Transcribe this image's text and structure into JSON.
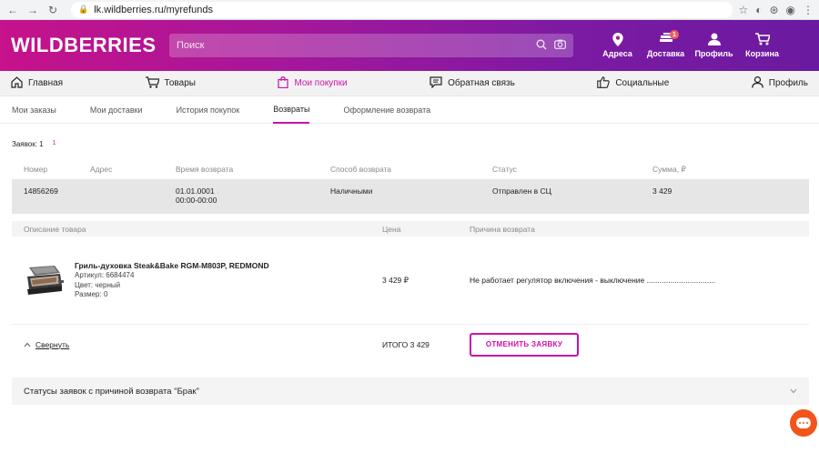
{
  "browser": {
    "url": "lk.wildberries.ru/myrefunds"
  },
  "header": {
    "logo": "WILDBERRIES",
    "search_placeholder": "Поиск",
    "links": [
      {
        "label": "Адреса",
        "icon": "location-icon"
      },
      {
        "label": "Доставка",
        "icon": "delivery-icon",
        "badge": "1"
      },
      {
        "label": "Профиль",
        "icon": "profile-icon"
      },
      {
        "label": "Корзина",
        "icon": "cart-icon"
      }
    ]
  },
  "mainnav": {
    "items": [
      {
        "label": "Главная",
        "icon": "home-icon"
      },
      {
        "label": "Товары",
        "icon": "cart-icon"
      },
      {
        "label": "Мои покупки",
        "icon": "bag-icon",
        "active": true
      },
      {
        "label": "Обратная связь",
        "icon": "feedback-icon"
      },
      {
        "label": "Социальные",
        "icon": "like-icon"
      },
      {
        "label": "Профиль",
        "icon": "user-icon"
      }
    ]
  },
  "subtabs": [
    "Мои заказы",
    "Мои доставки",
    "История покупок",
    "Возвраты",
    "Оформление возврата"
  ],
  "count": {
    "label": "Заявок: 1",
    "page": "1"
  },
  "table": {
    "headers": [
      "Номер",
      "Адрес",
      "Время возврата",
      "Способ возврата",
      "Статус",
      "Сумма, ₽"
    ],
    "row": {
      "number": "14856269",
      "address": "",
      "date": "01.01.0001",
      "time": "00:00-00:00",
      "method": "Наличными",
      "status": "Отправлен в СЦ",
      "sum": "3 429"
    }
  },
  "details": {
    "headers": [
      "Описание товара",
      "Цена",
      "Причина возврата"
    ],
    "product": {
      "name": "Гриль-духовка Steak&Bake RGM-M803P, REDMOND",
      "article": "Артикул:   6684474",
      "color": "Цвет:   черный",
      "size": "Размер:   0",
      "price": "3 429 ₽",
      "reason": "Не работает регулятор включения - выключение ................................"
    },
    "collapse_label": "Свернуть",
    "total": "ИТОГО 3 429",
    "cancel_label": "ОТМЕНИТЬ ЗАЯВКУ"
  },
  "statuses_label": "Статусы заявок с причиной возврата \"Брак\"",
  "colors": {
    "brand": "#cb11ab",
    "chat": "#f2541b"
  }
}
